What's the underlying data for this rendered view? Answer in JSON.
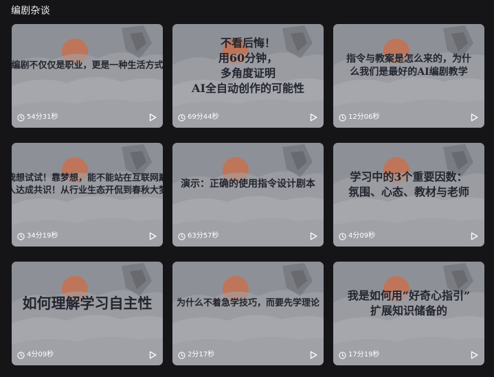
{
  "section": {
    "title": "编剧杂谈"
  },
  "cards": [
    {
      "title": "编剧不仅仅是职业，更是一种生活方式",
      "duration": "54分31秒"
    },
    {
      "title": "不看后悔！\n用60分钟，\n多角度证明\nAI全自动创作的可能性",
      "duration": "69分44秒"
    },
    {
      "title": "指令与教案是怎么来的，为什\n么我们是最好的AI编剧教学",
      "duration": "12分06秒"
    },
    {
      "title": "我想试试！靠梦想，能不能站在互联网巅\n人达成共识！从行业生态开侃到春秋大梦",
      "duration": "34分19秒"
    },
    {
      "title": "演示：正确的使用指令设计剧本",
      "duration": "63分57秒"
    },
    {
      "title": "学习中的3个重要因数：\n氛围、心态、教材与老师",
      "duration": "4分09秒"
    },
    {
      "title": "如何理解学习自主性",
      "duration": "4分09秒"
    },
    {
      "title": "为什么不着急学技巧，而要先学理论",
      "duration": "2分17秒"
    },
    {
      "title": "我是如何用“好奇心指引”\n扩展知识储备的",
      "duration": "17分19秒"
    }
  ],
  "icons": {
    "duration": "clock-icon",
    "play": "play-icon"
  },
  "colors": {
    "page_background": "#151517",
    "card_overlay": "#8e9097",
    "title_text": "#22252e",
    "sun": "#c7714f"
  }
}
